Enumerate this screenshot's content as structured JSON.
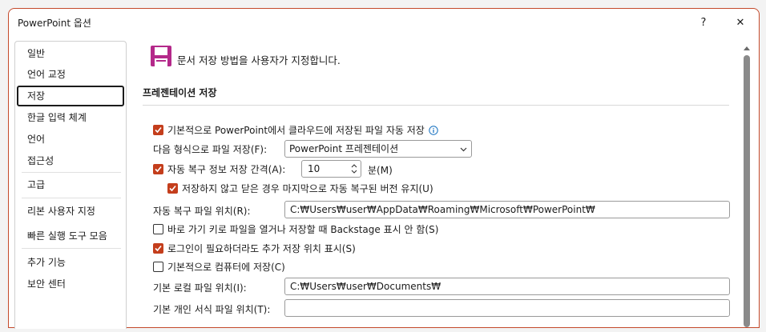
{
  "window": {
    "title": "PowerPoint 옵션",
    "help_glyph": "?",
    "close_glyph": "✕"
  },
  "sidebar": {
    "items": [
      {
        "label": "일반"
      },
      {
        "label": "언어 교정"
      },
      {
        "label": "저장"
      },
      {
        "label": "한글 입력 체계"
      },
      {
        "label": "언어"
      },
      {
        "label": "접근성"
      },
      {
        "label": "고급"
      },
      {
        "label": "리본 사용자 지정"
      },
      {
        "label": "빠른 실행 도구 모음"
      },
      {
        "label": "추가 기능"
      },
      {
        "label": "보안 센터"
      }
    ],
    "selected": "저장"
  },
  "content": {
    "header": "문서 저장 방법을 사용자가 지정합니다.",
    "section_title": "프레젠테이션 저장",
    "autosave": {
      "label": "기본적으로 PowerPoint에서 클라우드에 저장된 파일 자동 저장",
      "checked": true
    },
    "save_format": {
      "label": "다음 형식으로 파일 저장(F):",
      "value": "PowerPoint 프레젠테이션"
    },
    "autorecover_interval": {
      "label": "자동 복구 정보 저장 간격(A):",
      "value": "10",
      "unit": "분(M)",
      "checked": true
    },
    "keep_last_autosaved": {
      "label": "저장하지 않고 닫은 경우 마지막으로 자동 복구된 버전 유지(U)",
      "checked": true
    },
    "autorecover_location": {
      "label": "자동 복구 파일 위치(R):",
      "value": "C:₩Users₩user₩AppData₩Roaming₩Microsoft₩PowerPoint₩"
    },
    "no_backstage": {
      "label": "바로 가기 키로 파일을 열거나 저장할 때 Backstage 표시 안 함(S)",
      "checked": false
    },
    "show_additional_places": {
      "label": "로그인이 필요하더라도 추가 저장 위치 표시(S)",
      "checked": true
    },
    "save_to_computer": {
      "label": "기본적으로 컴퓨터에 저장(C)",
      "checked": false
    },
    "default_local_location": {
      "label": "기본 로컬 파일 위치(I):",
      "value": "C:₩Users₩user₩Documents₩"
    },
    "default_template_location": {
      "label": "기본 개인 서식 파일 위치(T):",
      "value": ""
    }
  },
  "colors": {
    "accent": "#c43e1c",
    "save_icon": "#b4298a",
    "info_icon": "#0f6cbd"
  }
}
